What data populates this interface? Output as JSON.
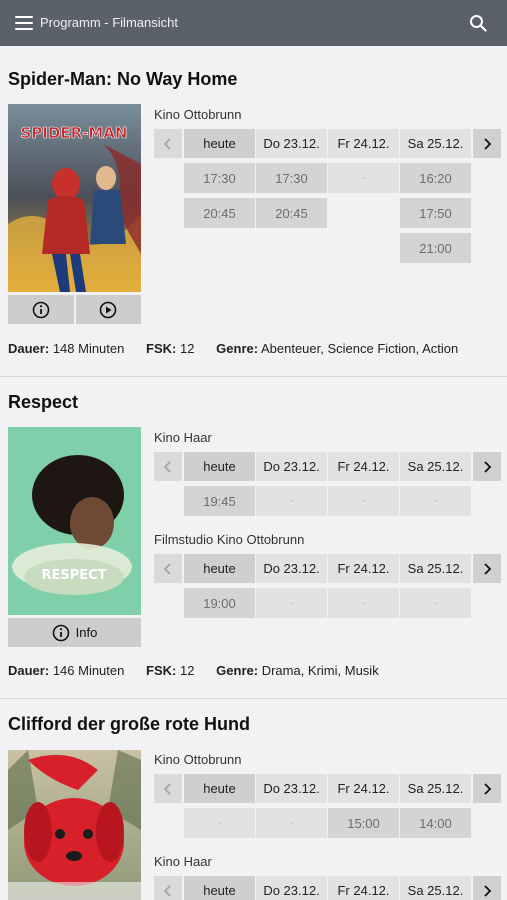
{
  "header": {
    "title": "Programm - Filmansicht"
  },
  "movies": [
    {
      "title": "Spider-Man: No Way Home",
      "poster_text": "SPIDER-MAN",
      "buttons": {
        "info_label": "",
        "trailer_label": ""
      },
      "meta": {
        "duration_label": "Dauer:",
        "duration": "148 Minuten",
        "fsk_label": "FSK:",
        "fsk": "12",
        "genre_label": "Genre:",
        "genre": "Abenteuer, Science Fiction, Action"
      },
      "cinemas": [
        {
          "name": "Kino Ottobrunn",
          "days": [
            {
              "label": "heute",
              "slots": [
                "17:30",
                "20:45"
              ]
            },
            {
              "label": "Do 23.12.",
              "slots": [
                "17:30",
                "20:45"
              ]
            },
            {
              "label": "Fr 24.12.",
              "slots": [
                "-"
              ]
            },
            {
              "label": "Sa 25.12.",
              "slots": [
                "16:20",
                "17:50",
                "21:00"
              ]
            }
          ]
        }
      ]
    },
    {
      "title": "Respect",
      "poster_text": "RESPECT",
      "buttons": {
        "info_label": "Info"
      },
      "meta": {
        "duration_label": "Dauer:",
        "duration": "146 Minuten",
        "fsk_label": "FSK:",
        "fsk": "12",
        "genre_label": "Genre:",
        "genre": "Drama, Krimi, Musik"
      },
      "cinemas": [
        {
          "name": "Kino Haar",
          "days": [
            {
              "label": "heute",
              "slots": [
                "19:45"
              ]
            },
            {
              "label": "Do 23.12.",
              "slots": [
                "-"
              ]
            },
            {
              "label": "Fr 24.12.",
              "slots": [
                "-"
              ]
            },
            {
              "label": "Sa 25.12.",
              "slots": [
                "-"
              ]
            }
          ]
        },
        {
          "name": "Filmstudio Kino Ottobrunn",
          "days": [
            {
              "label": "heute",
              "slots": [
                "19:00"
              ]
            },
            {
              "label": "Do 23.12.",
              "slots": [
                "-"
              ]
            },
            {
              "label": "Fr 24.12.",
              "slots": [
                "-"
              ]
            },
            {
              "label": "Sa 25.12.",
              "slots": [
                "-"
              ]
            }
          ]
        }
      ]
    },
    {
      "title": "Clifford der große rote Hund",
      "cinemas": [
        {
          "name": "Kino Ottobrunn",
          "days": [
            {
              "label": "heute",
              "slots": [
                "-"
              ]
            },
            {
              "label": "Do 23.12.",
              "slots": [
                "-"
              ]
            },
            {
              "label": "Fr 24.12.",
              "slots": [
                "15:00"
              ]
            },
            {
              "label": "Sa 25.12.",
              "slots": [
                "14:00"
              ]
            }
          ]
        },
        {
          "name": "Kino Haar",
          "days": [
            {
              "label": "heute",
              "slots": []
            },
            {
              "label": "Do 23.12.",
              "slots": []
            },
            {
              "label": "Fr 24.12.",
              "slots": []
            },
            {
              "label": "Sa 25.12.",
              "slots": []
            }
          ]
        }
      ]
    }
  ],
  "colors": {
    "topbar": "#5b6168",
    "spiderman_poster": "#b8312a",
    "respect_poster": "#7fcfa8",
    "clifford_poster": "#d8202a"
  },
  "icons": {
    "menu": "menu-icon",
    "search": "search-icon",
    "info": "info-icon",
    "play": "play-icon",
    "prev": "chevron-left-icon",
    "next": "chevron-right-icon"
  }
}
